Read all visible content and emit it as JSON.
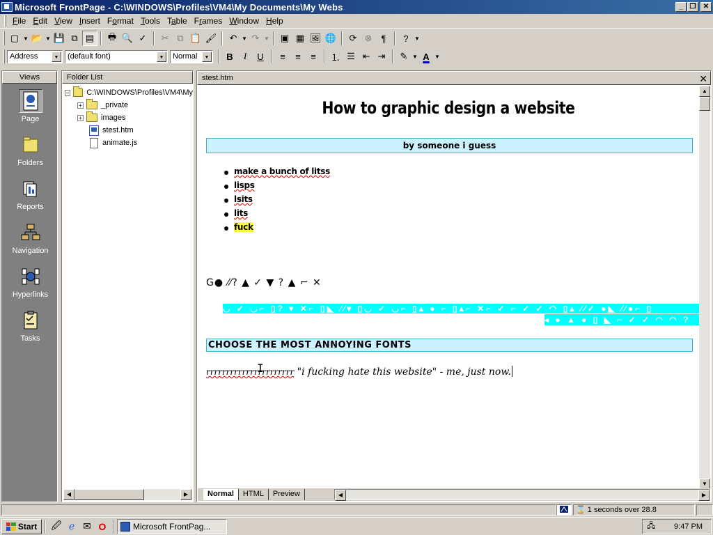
{
  "window": {
    "title": "Microsoft FrontPage - C:\\WINDOWS\\Profiles\\VM4\\My Documents\\My Webs",
    "buttons": {
      "minimize": "_",
      "maximize": "❐",
      "close": "✕"
    }
  },
  "menu": [
    {
      "label": "File",
      "accel": "F",
      "rest": "ile"
    },
    {
      "label": "Edit",
      "accel": "E",
      "rest": "dit"
    },
    {
      "label": "View",
      "accel": "V",
      "rest": "iew"
    },
    {
      "label": "Insert",
      "accel": "I",
      "rest": "nsert"
    },
    {
      "label": "Format",
      "accel": "o",
      "pre": "F",
      "rest": "rmat"
    },
    {
      "label": "Tools",
      "accel": "T",
      "rest": "ools"
    },
    {
      "label": "Table",
      "accel": "a",
      "pre": "T",
      "rest": "ble"
    },
    {
      "label": "Frames",
      "accel": "r",
      "pre": "F",
      "rest": "ames"
    },
    {
      "label": "Window",
      "accel": "W",
      "rest": "indow"
    },
    {
      "label": "Help",
      "accel": "H",
      "rest": "elp"
    }
  ],
  "format_toolbar": {
    "style": "Address",
    "font": "(default font)",
    "size": "Normal",
    "bold": "B",
    "italic": "I",
    "underline": "U"
  },
  "views": {
    "header": "Views",
    "items": [
      {
        "label": "Page",
        "icon": "page-view-icon",
        "selected": true
      },
      {
        "label": "Folders",
        "icon": "folders-view-icon"
      },
      {
        "label": "Reports",
        "icon": "reports-view-icon"
      },
      {
        "label": "Navigation",
        "icon": "navigation-view-icon"
      },
      {
        "label": "Hyperlinks",
        "icon": "hyperlinks-view-icon"
      },
      {
        "label": "Tasks",
        "icon": "tasks-view-icon"
      }
    ]
  },
  "folder_list": {
    "header": "Folder List",
    "root": "C:\\WINDOWS\\Profiles\\VM4\\My",
    "items": [
      {
        "label": "_private",
        "type": "folder"
      },
      {
        "label": "images",
        "type": "folder"
      },
      {
        "label": "stest.htm",
        "type": "htm"
      },
      {
        "label": "animate.js",
        "type": "file"
      }
    ]
  },
  "editor": {
    "tab_title": "stest.htm",
    "close": "✕",
    "bottom_tabs": [
      "Normal",
      "HTML",
      "Preview"
    ]
  },
  "document": {
    "heading": "How to graphic design a website",
    "byline": "by someone i guess",
    "bullets": [
      "make a bunch of litss",
      "lisps",
      "lsits",
      "lits",
      "fuck"
    ],
    "dingbat_line": "G● ⁄⁄? ▲ ✓ ▼ ? ▲ ⌐ ✕",
    "marquee_1": "◡ ✓ ◡⌐ ▯? ▾ ✕⌐ ▯◣ ⁄⁄▾ ▯◡ ✓ ◡⌐ ▯▴ ● ⌐ ▯▴⌐ ✕⌐ ✓ ⌐ ✓ ✓ ◠ ▯▴ ⁄⁄✓ ●◣ ⁄⁄●⌐ ▯",
    "marquee_2": "◂ ● ▲ ● ▯ ◣ ⌐ ✓ ✓ ◠ ◠ ?",
    "annoying_heading": "CHOOSE THE MOST ANNOYING FONTS",
    "rrrr": "rrrrrrrrrrrrrrrrrrrrrr",
    "quote": " \"i fucking hate this website\" - me, just now."
  },
  "status": {
    "download_time": "1 seconds over 28.8"
  },
  "taskbar": {
    "start": "Start",
    "task": "Microsoft FrontPag...",
    "clock": "9:47 PM"
  },
  "colors": {
    "titlebar_start": "#0a246a",
    "titlebar_end": "#3a6ea5",
    "cyan": "#00ffff",
    "light_cyan": "#ccf2ff",
    "highlight": "#ffff40"
  }
}
